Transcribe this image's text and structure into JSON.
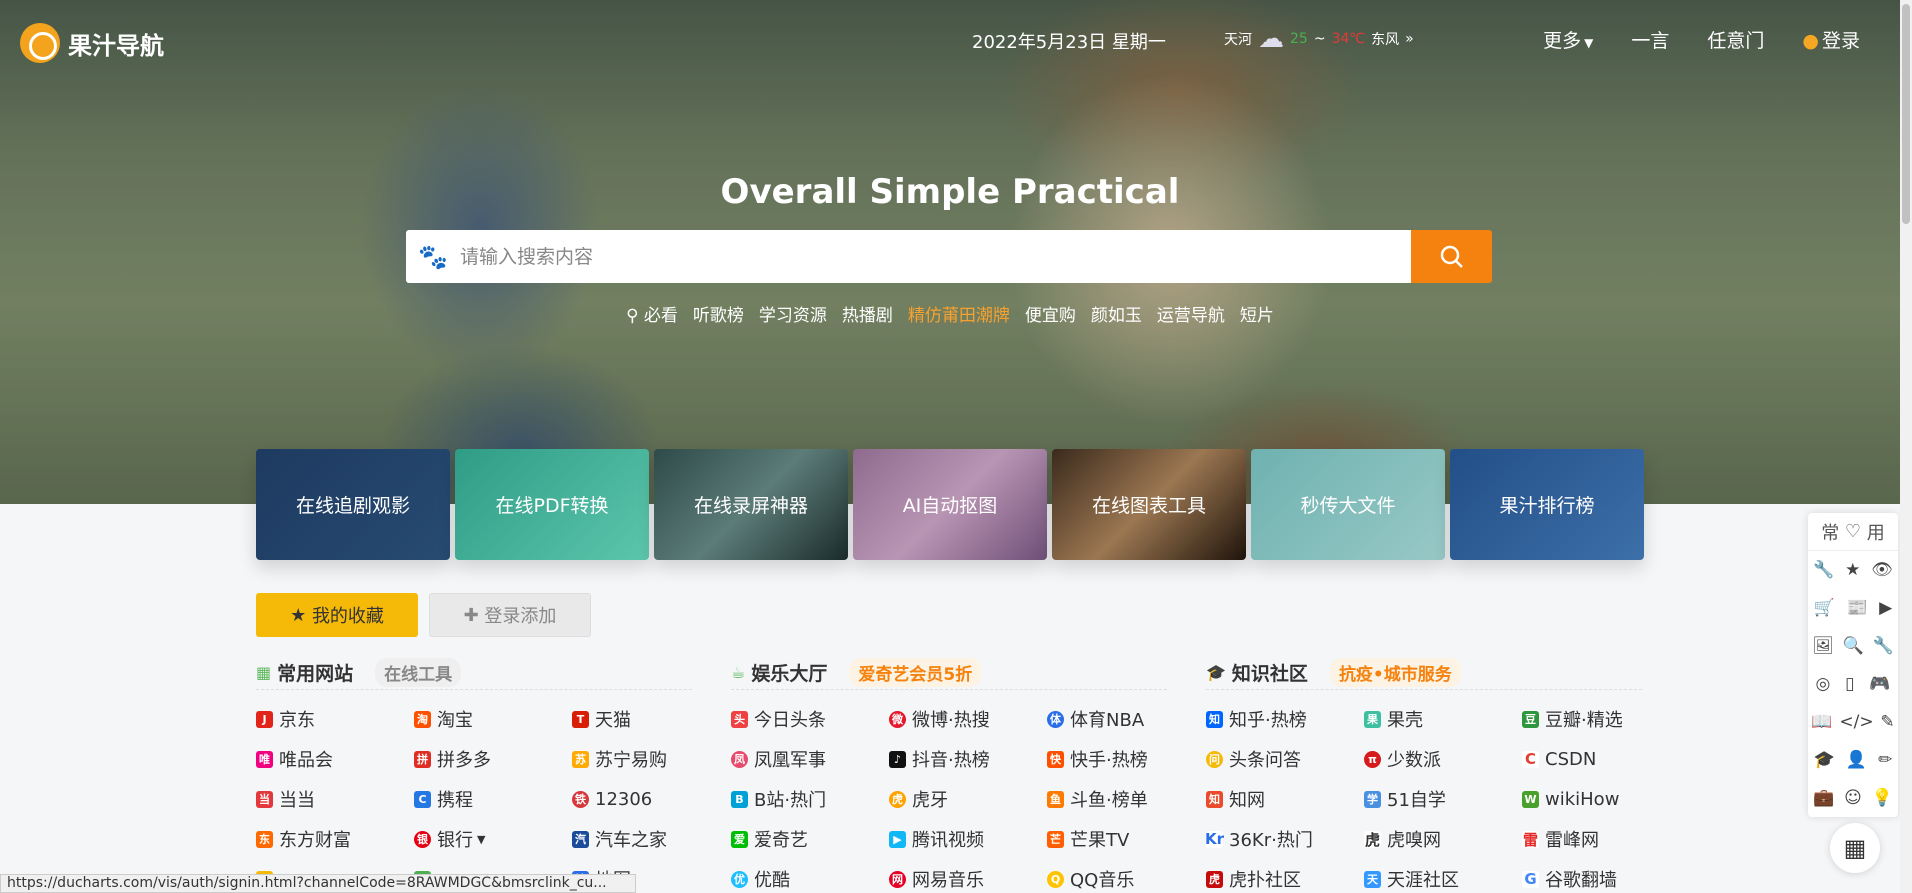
{
  "header": {
    "logo_text": "果汁导航",
    "date": "2022年5月23日 星期一",
    "weather": {
      "city": "天河",
      "low": "25",
      "sep": "~",
      "high": "34℃",
      "wind": "东风",
      "more": "»"
    },
    "nav": {
      "more": "更多",
      "one_word": "一言",
      "random": "任意门",
      "login": "登录"
    }
  },
  "hero": {
    "slogan": "Overall Simple Practical",
    "search_placeholder": "请输入搜索内容",
    "hot_label": "必看",
    "hot_links": [
      "听歌榜",
      "学习资源",
      "热播剧",
      "精仿莆田潮牌",
      "便宜购",
      "颜如玉",
      "运营导航",
      "短片"
    ]
  },
  "features": [
    "在线追剧观影",
    "在线PDF转换",
    "在线录屏神器",
    "AI自动抠图",
    "在线图表工具",
    "秒传大文件",
    "果汁排行榜"
  ],
  "tabs": {
    "favorites": "我的收藏",
    "login_add": "登录添加"
  },
  "columns": [
    {
      "title": "常用网站",
      "tag": "在线工具",
      "links": [
        "京东",
        "淘宝",
        "天猫",
        "唯品会",
        "拼多多",
        "苏宁易购",
        "当当",
        "携程",
        "12306",
        "东方财富",
        "银行",
        "汽车之家",
        "",
        "",
        "地图"
      ]
    },
    {
      "title": "娱乐大厅",
      "tag": "爱奇艺会员5折",
      "links": [
        "今日头条",
        "微博·热搜",
        "体育NBA",
        "凤凰军事",
        "抖音·热榜",
        "快手·热榜",
        "B站·热门",
        "虎牙",
        "斗鱼·榜单",
        "爱奇艺",
        "腾讯视频",
        "芒果TV",
        "优酷",
        "网易音乐",
        "QQ音乐"
      ]
    },
    {
      "title": "知识社区",
      "tag": "抗疫•城市服务",
      "links": [
        "知乎·热榜",
        "果壳",
        "豆瓣·精选",
        "头条问答",
        "少数派",
        "CSDN",
        "知网",
        "51自学",
        "wikiHow",
        "36Kr·热门",
        "虎嗅网",
        "雷峰网",
        "虎扑社区",
        "天涯社区",
        "谷歌翻墙"
      ]
    }
  ],
  "sidebar": {
    "title": "常",
    "title2": "用"
  },
  "status_url": "https://ducharts.com/vis/auth/signin.html?channelCode=8RAWMDGC&bmsrclink_cu...",
  "colors": {
    "accent": "#f5820e",
    "yellow": "#f5b908"
  }
}
